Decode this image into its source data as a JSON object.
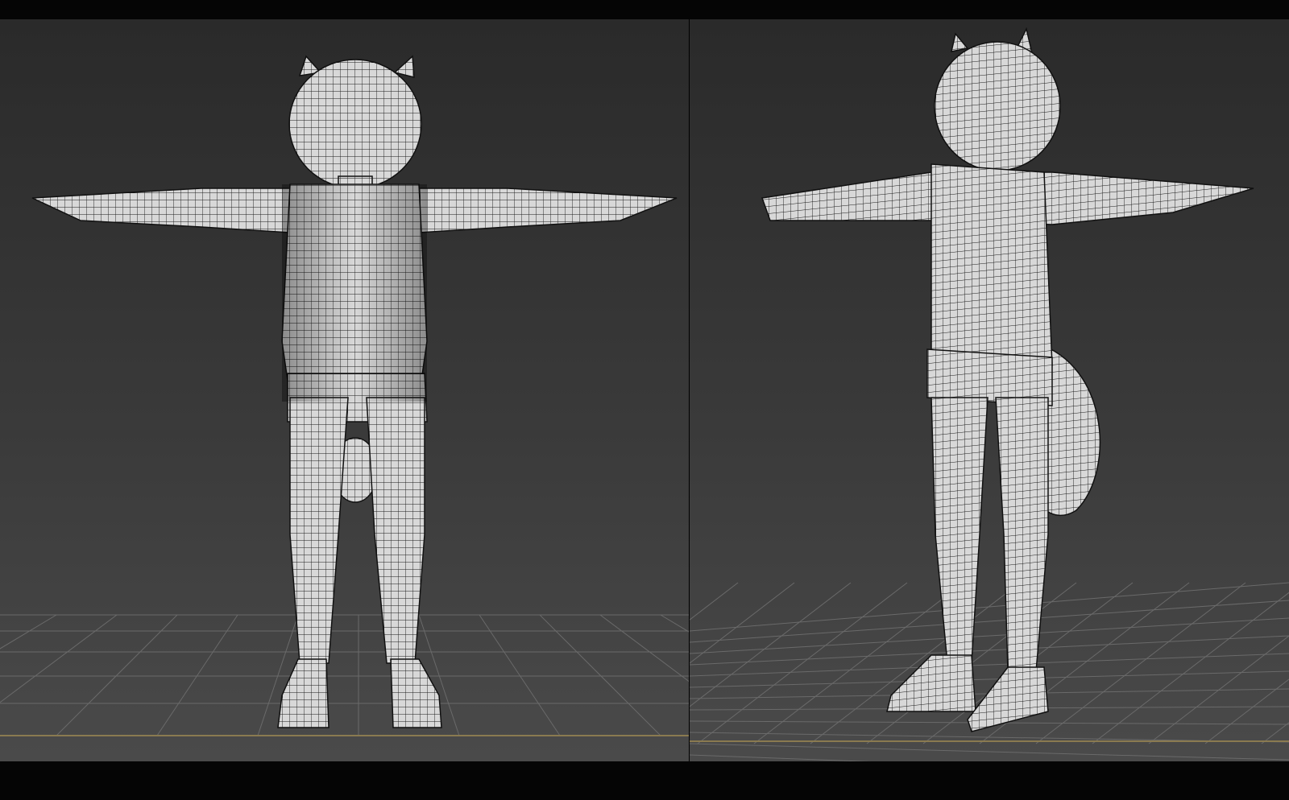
{
  "viewports": [
    {
      "view": "front",
      "shading": "wireframe-on-shaded"
    },
    {
      "view": "perspective",
      "shading": "wireframe-on-shaded"
    }
  ],
  "colors": {
    "background_top": "#2a2a2a",
    "background_bottom": "#4a4a4a",
    "grid": "#6a6a6a",
    "ground_line": "#8a7a50",
    "mesh_fill": "#d8d8d8",
    "mesh_wire": "#1a1a1a"
  }
}
